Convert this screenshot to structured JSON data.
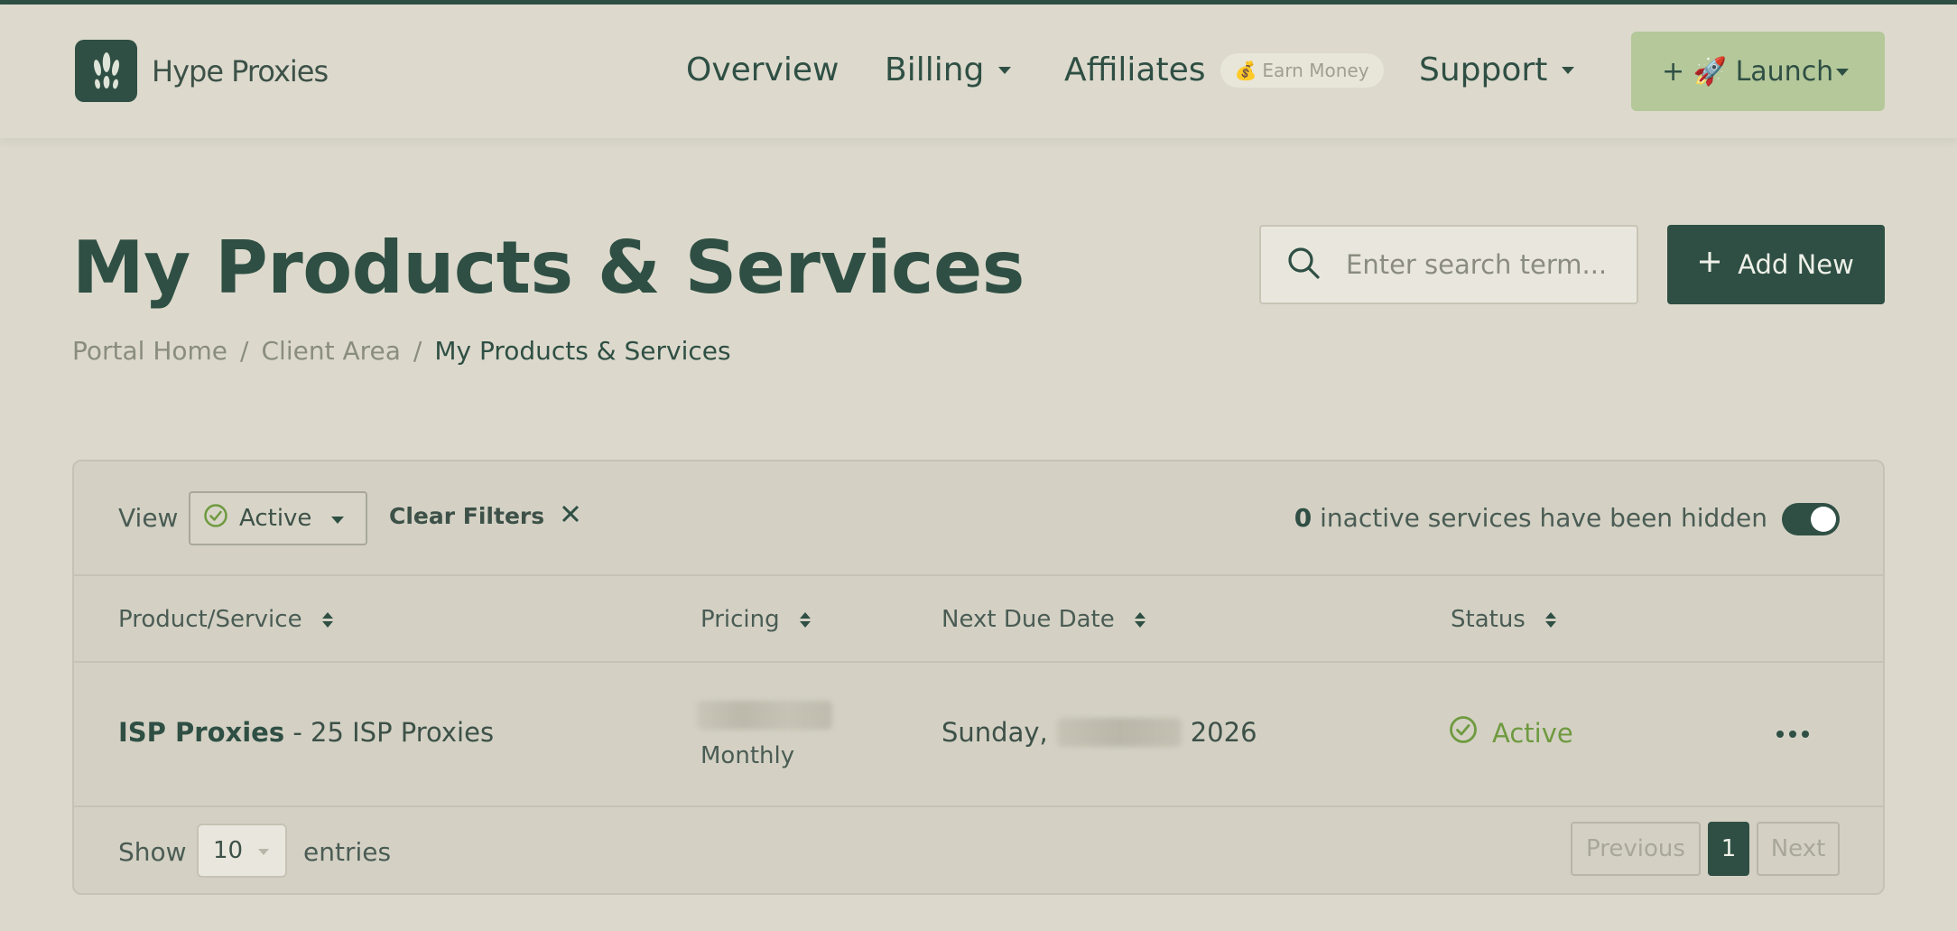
{
  "brand": {
    "name": "Hype Proxies"
  },
  "nav": {
    "overview": "Overview",
    "billing": "Billing",
    "affiliates": "Affiliates",
    "earn_badge": "Earn Money",
    "support": "Support",
    "launch": "+ 🚀 Launch"
  },
  "page": {
    "title": "My Products & Services",
    "breadcrumb": [
      "Portal Home",
      "Client Area",
      "My Products & Services"
    ]
  },
  "search": {
    "placeholder": "Enter search term..."
  },
  "add_new": {
    "label": "Add New"
  },
  "filters": {
    "view_label": "View",
    "view_value": "Active",
    "clear_label": "Clear Filters",
    "hidden_count": "0",
    "hidden_text": "inactive services have been hidden",
    "toggle_on": true
  },
  "table": {
    "columns": [
      "Product/Service",
      "Pricing",
      "Next Due Date",
      "Status"
    ],
    "rows": [
      {
        "product_name": "ISP Proxies",
        "product_detail": "- 25 ISP Proxies",
        "billing_cycle": "Monthly",
        "due_prefix": "Sunday,",
        "due_year": "2026",
        "status": "Active"
      }
    ]
  },
  "pagination": {
    "show_label": "Show",
    "entries_value": "10",
    "entries_label": "entries",
    "previous": "Previous",
    "current_page": "1",
    "next": "Next"
  },
  "colors": {
    "primary": "#2f4f44",
    "background": "#dcd9cc",
    "launch": "#b4c89a",
    "active_green": "#6f9a40"
  }
}
